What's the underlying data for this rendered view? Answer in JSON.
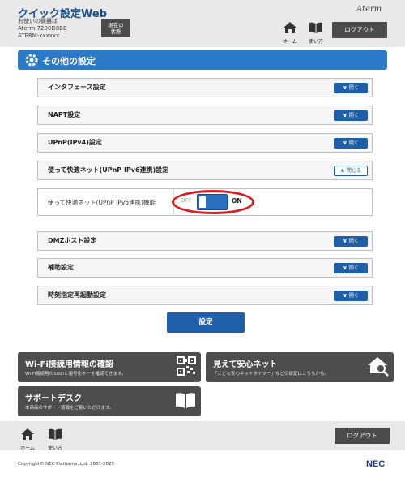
{
  "header": {
    "title": "クイック設定Web",
    "model_prefix": "お使いの機器は",
    "model_name": "Aterm 7200D8BE",
    "device_id": "ATERM-xxxxxx",
    "status_button": [
      "現在の",
      "状態"
    ],
    "brand": "Aterm",
    "home_label": "ホーム",
    "manual_label": "使い方",
    "logout_label": "ログアウト"
  },
  "section": {
    "title": "その他の設定"
  },
  "accordions": [
    {
      "label": "インタフェース設定",
      "action": "開く"
    },
    {
      "label": "NAPT設定",
      "action": "開く"
    },
    {
      "label": "UPnP(IPv4)設定",
      "action": "開く"
    },
    {
      "label": "使って快適ネット(UPnP IPv6連携)設定",
      "action": "閉じる"
    },
    {
      "label": "DMZホスト設定",
      "action": "開く"
    },
    {
      "label": "補助設定",
      "action": "開く"
    },
    {
      "label": "時刻指定再起動設定",
      "action": "開く"
    }
  ],
  "expanded": {
    "setting_label": "使って快適ネット(UPnP IPv6連携)機能",
    "toggle_off": "OFF",
    "toggle_on": "ON",
    "toggle_state": "ON"
  },
  "apply_label": "設定",
  "cards": {
    "wifi": {
      "title": "Wi-Fi接続用情報の確認",
      "desc": "Wi-Fi接続用のSSIDと暗号化キーを確認できます。",
      "icon": "qr-code-icon"
    },
    "safety": {
      "title": "見えて安心ネット",
      "desc": "「こども安心ネットタイマー」などの設定はこちらから。",
      "icon": "house-search-icon"
    },
    "support": {
      "title": "サポートデスク",
      "desc": "本商品のサポート情報をご覧いただけます。",
      "icon": "book-icon"
    }
  },
  "footer": {
    "home_label": "ホーム",
    "manual_label": "使い方",
    "logout_label": "ログアウト",
    "copyright": "Copyright© NEC Platforms, Ltd. 2001-2025",
    "logo": "NEC"
  },
  "colors": {
    "accent": "#2a7ac8",
    "button": "#1f5fa8",
    "card": "#4d4d4d",
    "highlight": "#e01b1b"
  }
}
